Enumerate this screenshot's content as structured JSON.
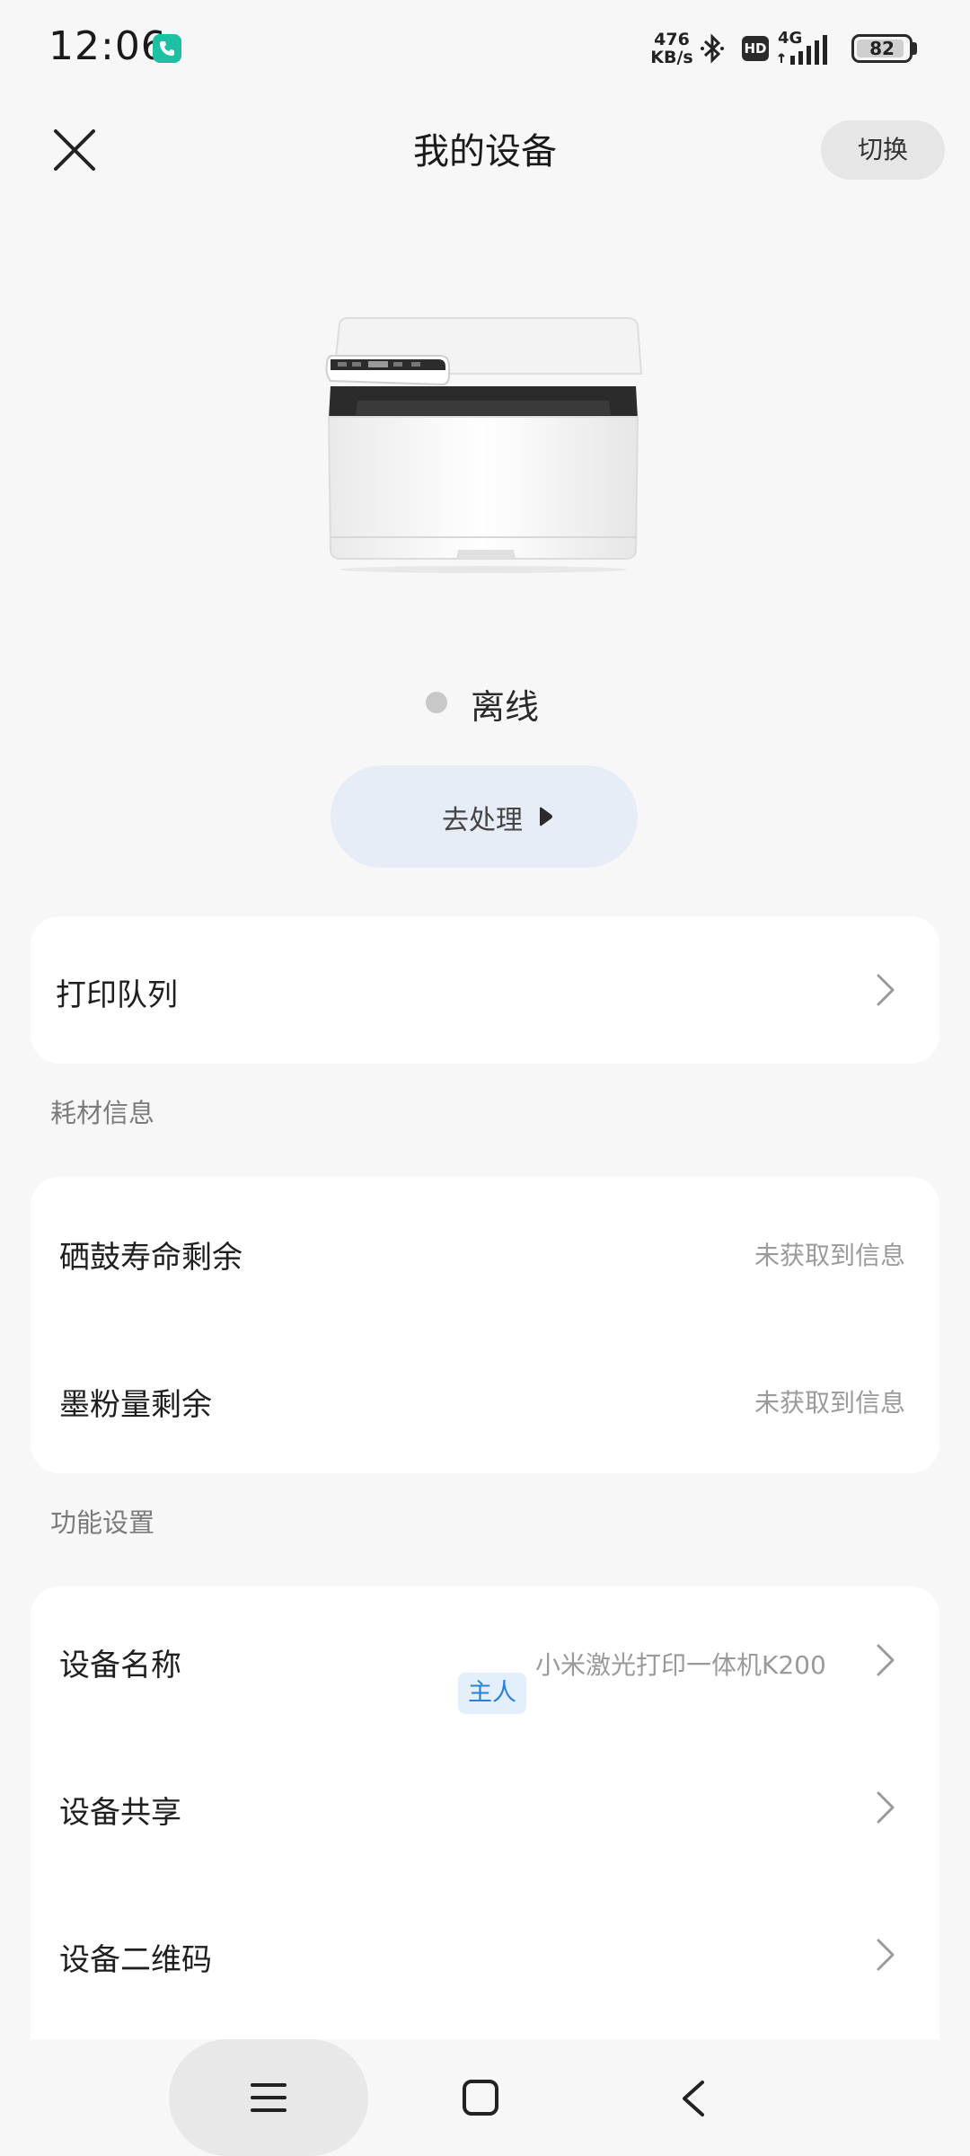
{
  "status_bar": {
    "time": "12:06",
    "net_speed_value": "476",
    "net_speed_unit": "KB/s",
    "hd_label": "HD",
    "network_type": "4G",
    "battery_level": "82"
  },
  "header": {
    "title": "我的设备",
    "switch_label": "切换"
  },
  "device": {
    "status_text": "离线",
    "action_label": "去处理"
  },
  "print_queue": {
    "label": "打印队列"
  },
  "consumables": {
    "section_label": "耗材信息",
    "items": [
      {
        "label": "硒鼓寿命剩余",
        "value": "未获取到信息"
      },
      {
        "label": "墨粉量剩余",
        "value": "未获取到信息"
      }
    ]
  },
  "settings": {
    "section_label": "功能设置",
    "items": [
      {
        "label": "设备名称",
        "tag": "主人",
        "value": "小米激光打印一体机K200"
      },
      {
        "label": "设备共享"
      },
      {
        "label": "设备二维码"
      }
    ]
  },
  "colors": {
    "background": "#f7f7f7",
    "card": "#ffffff",
    "action_button": "#e6edf6",
    "owner_tag_text": "#2a82d6",
    "owner_tag_bg": "#e3f0fb",
    "offline_dot": "#c8c8c8"
  },
  "icons": {
    "close": "close-icon",
    "chevron": "chevron-right-icon",
    "nav_menu": "menu-icon",
    "nav_home": "home-square-icon",
    "nav_back": "back-arrow-icon"
  }
}
